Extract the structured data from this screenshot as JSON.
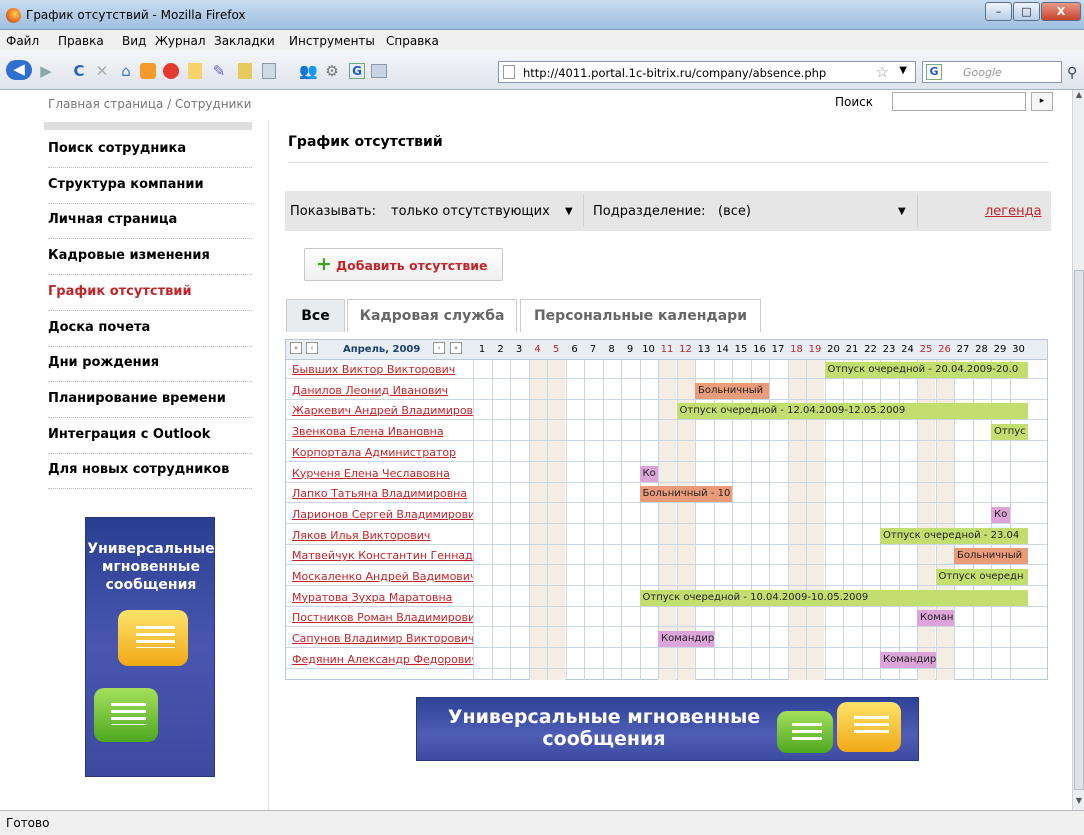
{
  "window": {
    "title": "График отсутствий - Mozilla Firefox",
    "controls": {
      "minimize": "–",
      "maximize": "□",
      "close": "X"
    }
  },
  "menu": [
    "Файл",
    "Правка",
    "Вид",
    "Журнал",
    "Закладки",
    "Инструменты",
    "Справка"
  ],
  "toolbar": {
    "url": "http://4011.portal.1c-bitrix.ru/company/absence.php",
    "search_placeholder": "Google",
    "icons": [
      "back-icon",
      "forward-icon",
      "reload-icon",
      "stop-icon",
      "home-icon",
      "rss-icon",
      "bookmark-icon"
    ]
  },
  "page": {
    "breadcrumb": "Главная страница / Сотрудники",
    "search_label": "Поиск",
    "search_button": "▸",
    "title": "График отсутствий"
  },
  "sidebar": {
    "items": [
      {
        "label": "Поиск сотрудника"
      },
      {
        "label": "Структура компании"
      },
      {
        "label": "Личная страница"
      },
      {
        "label": "Кадровые изменения"
      },
      {
        "label": "График отсутствий"
      },
      {
        "label": "Доска почета"
      },
      {
        "label": "Дни рождения"
      },
      {
        "label": "Планирование времени"
      },
      {
        "label": "Интеграция с Outlook"
      },
      {
        "label": "Для новых сотрудников"
      }
    ],
    "active_index": 4,
    "banner_text": "Универсальные мгновенные сообщения"
  },
  "filters": {
    "show_label": "Показывать:",
    "show_value": "только отсутствующих",
    "dept_label": "Подразделение:",
    "dept_value": "(все)",
    "legend_link": "легенда"
  },
  "add_button": "Добавить отсутствие",
  "tabs": [
    "Все",
    "Кадровая служба",
    "Персональные календари"
  ],
  "calendar": {
    "month": "Апрель, 2009",
    "nav": {
      "first": "«",
      "prev": "‹",
      "next": "›",
      "last": "»"
    },
    "weekend_days": [
      4,
      5,
      11,
      12,
      18,
      19,
      25,
      26
    ],
    "days": 30,
    "rows": [
      {
        "name": "Бывших Виктор Викторович",
        "bars": [
          {
            "kind": "vac",
            "start": 20,
            "end": 30,
            "label": "Отпуск очередной - 20.04.2009-20.0"
          }
        ]
      },
      {
        "name": "Данилов Леонид Иванович",
        "bars": [
          {
            "kind": "sick",
            "start": 13,
            "end": 16,
            "label": "Больничный"
          }
        ]
      },
      {
        "name": "Жаркевич Андрей Владимирович",
        "bars": [
          {
            "kind": "vac",
            "start": 12,
            "end": 30,
            "label": "Отпуск очередной - 12.04.2009-12.05.2009"
          }
        ]
      },
      {
        "name": "Звенкова Елена Ивановна",
        "bars": [
          {
            "kind": "vac",
            "start": 29,
            "end": 30,
            "label": "Отпус"
          }
        ]
      },
      {
        "name": "Корпортала Администратор",
        "bars": []
      },
      {
        "name": "Курченя Елена Чеславовна",
        "bars": [
          {
            "kind": "trip",
            "start": 10,
            "end": 10,
            "label": "Ко"
          }
        ]
      },
      {
        "name": "Лапко Татьяна Владимировна",
        "bars": [
          {
            "kind": "sick",
            "start": 10,
            "end": 14,
            "label": "Больничный - 10"
          }
        ]
      },
      {
        "name": "Ларионов Сергей Владимирович",
        "bars": [
          {
            "kind": "trip",
            "start": 29,
            "end": 29,
            "label": "Ко"
          }
        ]
      },
      {
        "name": "Ляков Илья Викторович",
        "bars": [
          {
            "kind": "vac",
            "start": 23,
            "end": 30,
            "label": "Отпуск очередной - 23.04"
          }
        ]
      },
      {
        "name": "Матвейчук Константин Геннадьевич",
        "bars": [
          {
            "kind": "sick",
            "start": 27,
            "end": 30,
            "label": "Больничный"
          }
        ]
      },
      {
        "name": "Москаленко Андрей Вадимович",
        "bars": [
          {
            "kind": "vac",
            "start": 26,
            "end": 30,
            "label": "Отпуск очередн"
          }
        ]
      },
      {
        "name": "Муратова Зухра Маратовна",
        "bars": [
          {
            "kind": "vac",
            "start": 10,
            "end": 30,
            "label": "Отпуск очередной - 10.04.2009-10.05.2009"
          }
        ]
      },
      {
        "name": "Постников Роман Владимирович",
        "bars": [
          {
            "kind": "trip",
            "start": 25,
            "end": 26,
            "label": "Коман"
          }
        ]
      },
      {
        "name": "Сапунов Владимир Викторович",
        "bars": [
          {
            "kind": "trip",
            "start": 11,
            "end": 13,
            "label": "Командир"
          }
        ]
      },
      {
        "name": "Федянин Александр Федорович",
        "bars": [
          {
            "kind": "trip",
            "start": 23,
            "end": 25,
            "label": "Командир"
          }
        ]
      }
    ]
  },
  "bottom_banner": "Универсальные мгновенные сообщения",
  "status": "Готово"
}
